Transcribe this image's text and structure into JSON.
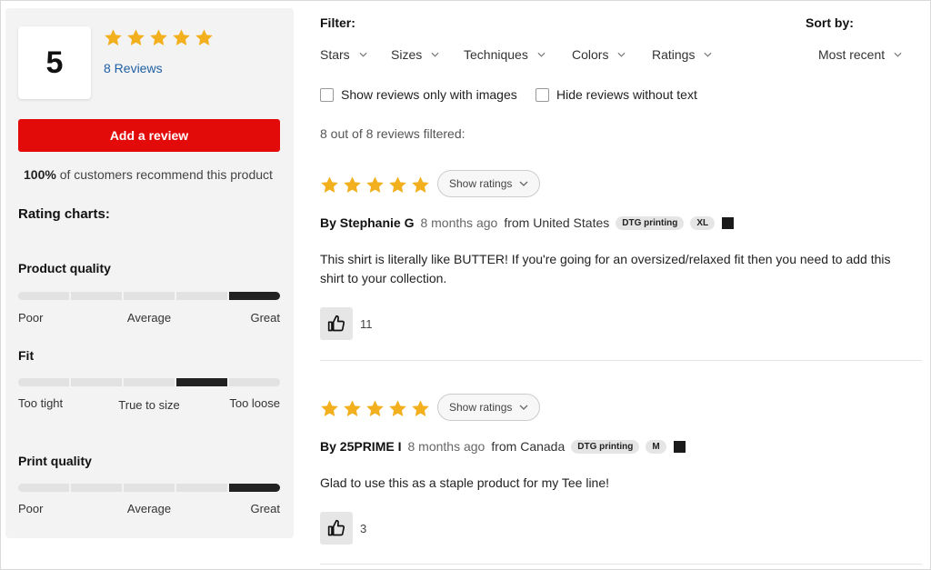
{
  "summary": {
    "score": "5",
    "stars": 5,
    "reviews_link": "8 Reviews",
    "add_review_label": "Add a review",
    "recommend_percent": "100%",
    "recommend_text": " of customers recommend this product",
    "charts_title": "Rating charts:",
    "charts": [
      {
        "label": "Product quality",
        "level": 5,
        "low": "Poor",
        "mid": "Average",
        "high": "Great"
      },
      {
        "label": "Fit",
        "level": 4,
        "low": "Too tight",
        "mid": "True to size",
        "high": "Too loose"
      },
      {
        "label": "Print quality",
        "level": 5,
        "low": "Poor",
        "mid": "Average",
        "high": "Great"
      }
    ]
  },
  "filters": {
    "filter_title": "Filter:",
    "sort_title": "Sort by:",
    "dropdowns": [
      "Stars",
      "Sizes",
      "Techniques",
      "Colors",
      "Ratings"
    ],
    "sort_value": "Most recent",
    "checkbox_images": "Show reviews only with images",
    "checkbox_text": "Hide reviews without text",
    "filtered_text": "8 out of 8 reviews filtered:"
  },
  "reviews": [
    {
      "stars": 5,
      "show_ratings": "Show ratings",
      "author": "By Stephanie G",
      "date": "8 months ago",
      "from": "from United States",
      "technique": "DTG printing",
      "size": "XL",
      "color": "#1a1a1a",
      "text": "This shirt is literally like BUTTER! If you're going for an oversized/relaxed fit then you need to add this shirt to your collection.",
      "likes": "11"
    },
    {
      "stars": 5,
      "show_ratings": "Show ratings",
      "author": "By 25PRIME I",
      "date": "8 months ago",
      "from": "from Canada",
      "technique": "DTG printing",
      "size": "M",
      "color": "#1a1a1a",
      "text": "Glad to use this as a staple product for my Tee line!",
      "likes": "3"
    }
  ],
  "colors": {
    "accent_red": "#e30a0a",
    "star_gold": "#f2b01e",
    "link_blue": "#1f5fa3"
  },
  "icons": {
    "star": "star-icon",
    "chevron": "chevron-down-icon",
    "thumb": "thumbs-up-icon"
  }
}
